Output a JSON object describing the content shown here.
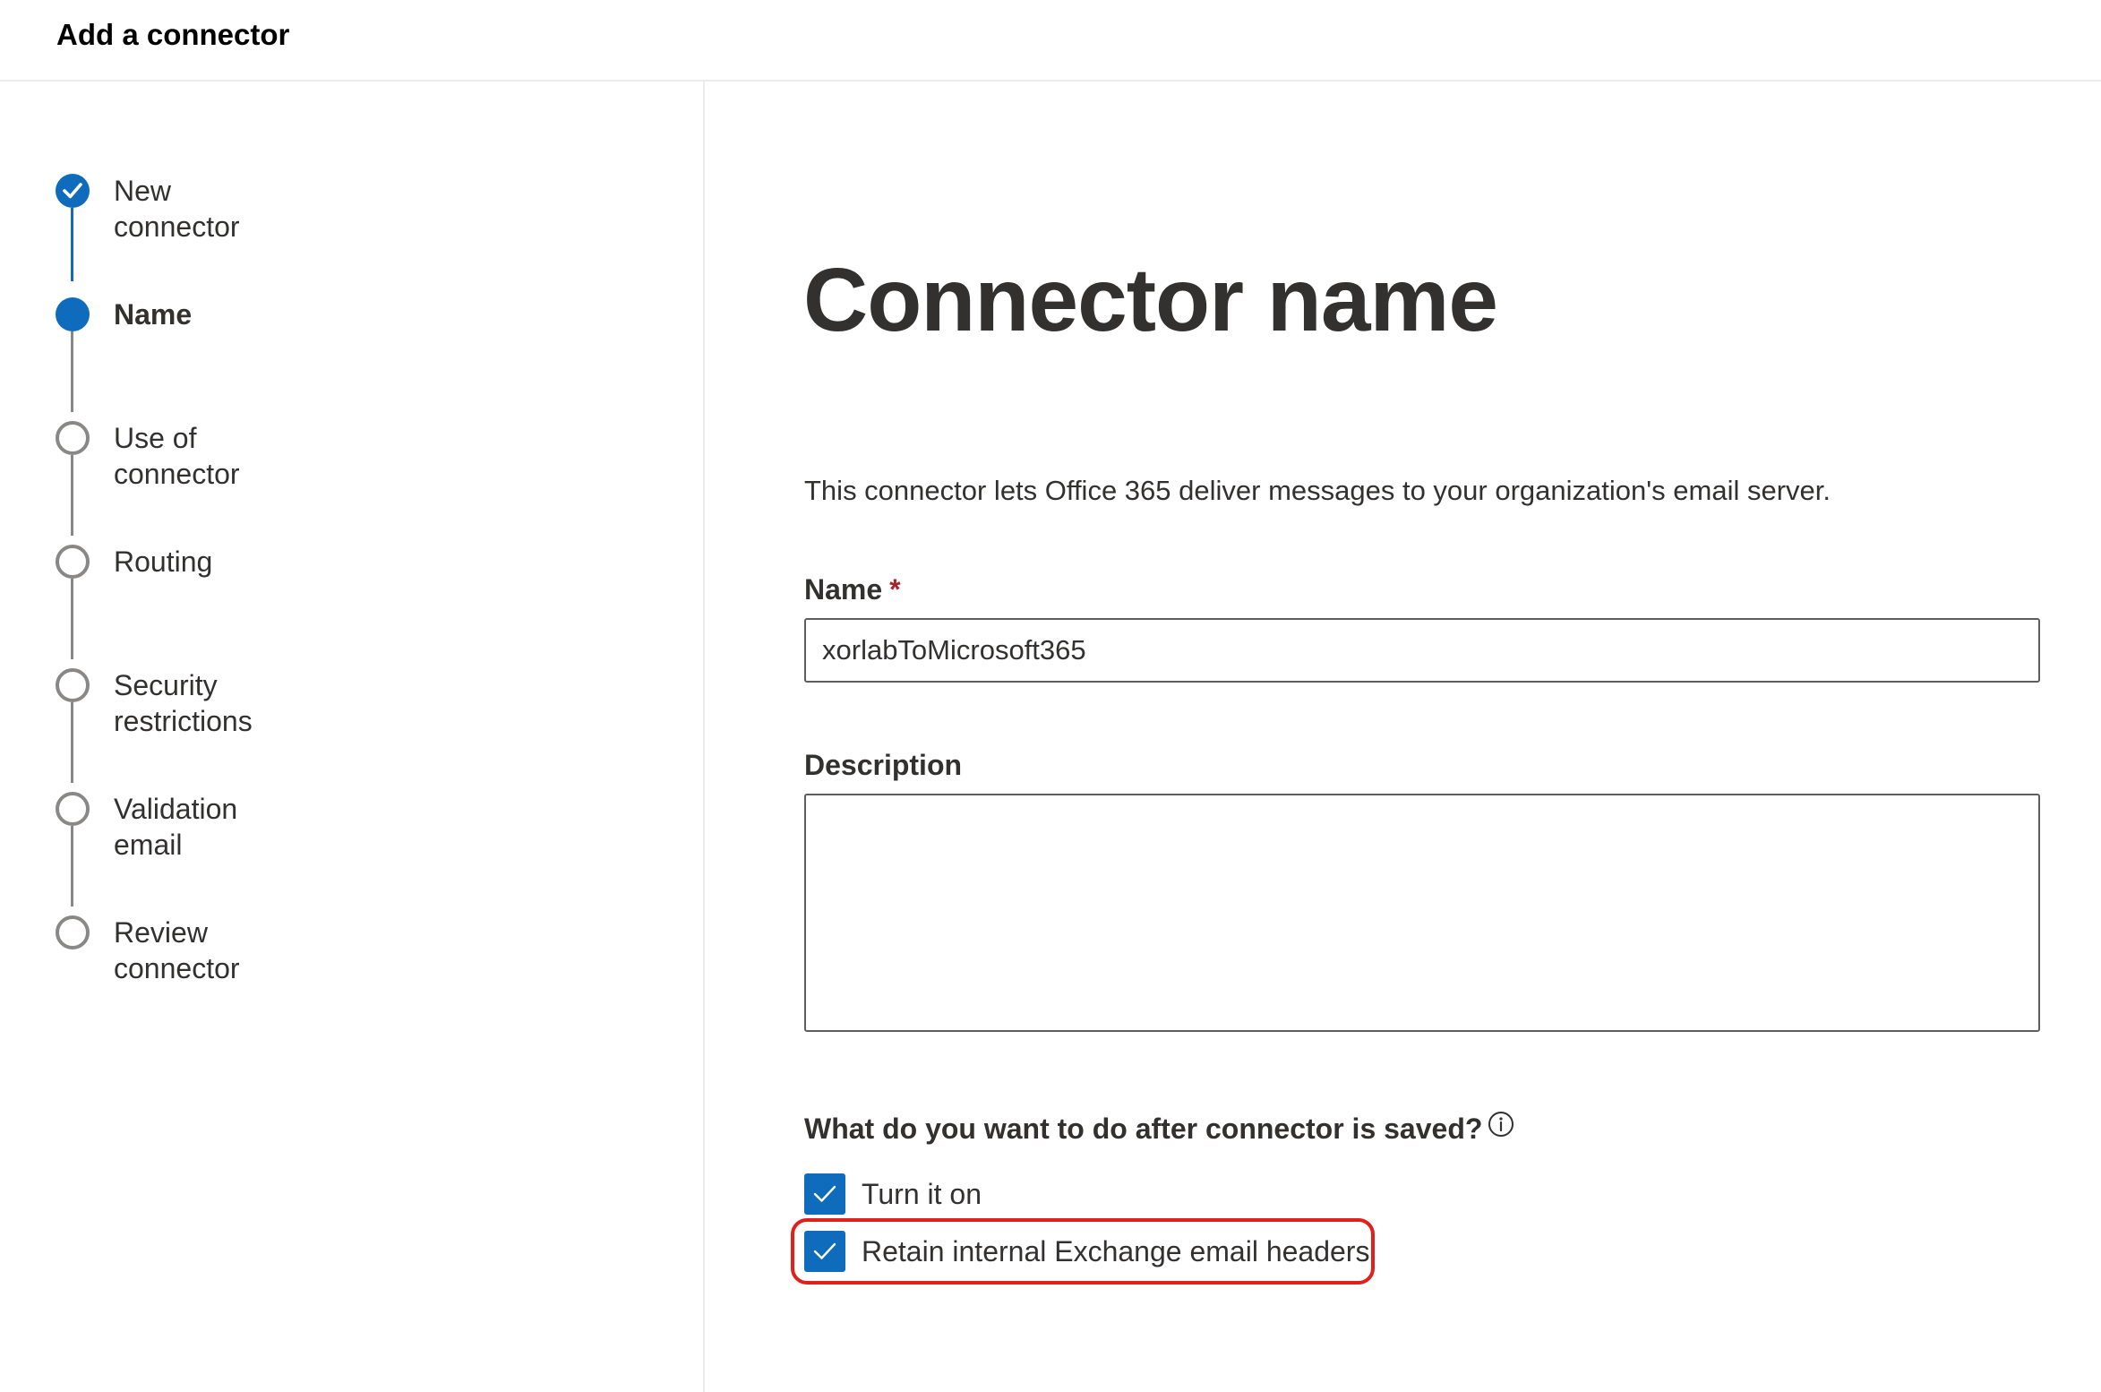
{
  "header": {
    "title": "Add a connector"
  },
  "steps": [
    {
      "label": "New connector",
      "state": "done"
    },
    {
      "label": "Name",
      "state": "current"
    },
    {
      "label": "Use of connector",
      "state": "pending"
    },
    {
      "label": "Routing",
      "state": "pending"
    },
    {
      "label": "Security restrictions",
      "state": "pending"
    },
    {
      "label": "Validation email",
      "state": "pending"
    },
    {
      "label": "Review connector",
      "state": "pending"
    }
  ],
  "main": {
    "title": "Connector name",
    "intro": "This connector lets Office 365 deliver messages to your organization's email server.",
    "name_field": {
      "label": "Name",
      "required_marker": "*",
      "value": "xorlabToMicrosoft365"
    },
    "description_field": {
      "label": "Description",
      "value": ""
    },
    "after_save": {
      "question": "What do you want to do after connector is saved?",
      "options": [
        {
          "label": "Turn it on",
          "checked": true
        },
        {
          "label": "Retain internal Exchange email headers",
          "checked": true
        }
      ]
    }
  },
  "colors": {
    "accent": "#0f6cbd",
    "highlight": "#e0211b",
    "required": "#a4262c"
  },
  "icons": {
    "step_done": "checkmark-circle-icon",
    "info": "info-icon",
    "checkbox_check": "checkmark-icon"
  }
}
